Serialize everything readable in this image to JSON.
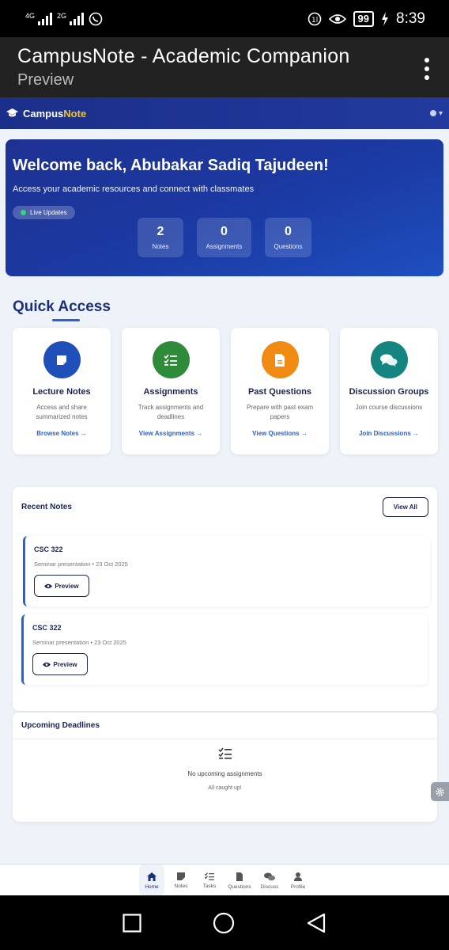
{
  "status_bar": {
    "net1": "4G",
    "net2": "2G",
    "battery": "99",
    "time": "8:39",
    "icons": [
      "whatsapp-icon",
      "data-saver-icon",
      "eye-icon",
      "charging-icon"
    ]
  },
  "appbar": {
    "title": "CampusNote - Academic Companion",
    "subtitle": "Preview"
  },
  "navbar": {
    "brand_prefix": "Campus",
    "brand_accent": "Note",
    "user_icon": "user-circle-icon"
  },
  "hero": {
    "heading": "Welcome back, Abubakar Sadiq Tajudeen!",
    "subtitle": "Access your academic resources and connect with classmates",
    "live_label": "Live Updates",
    "stats": [
      {
        "value": "2",
        "label": "Notes"
      },
      {
        "value": "0",
        "label": "Assignments"
      },
      {
        "value": "0",
        "label": "Questions"
      }
    ]
  },
  "quick_access": {
    "title": "Quick Access",
    "cards": [
      {
        "title": "Lecture Notes",
        "desc": "Access and share summarized notes",
        "link": "Browse Notes →",
        "color": "#1f4fb8",
        "icon": "note-icon"
      },
      {
        "title": "Assignments",
        "desc": "Track assignments and deadlines",
        "link": "View Assignments →",
        "color": "#2e8b3a",
        "icon": "checklist-icon"
      },
      {
        "title": "Past Questions",
        "desc": "Prepare with past exam papers",
        "link": "View Questions →",
        "color": "#f08a12",
        "icon": "file-icon"
      },
      {
        "title": "Discussion Groups",
        "desc": "Join course discussions",
        "link": "Join Discussions →",
        "color": "#15857f",
        "icon": "comments-icon"
      }
    ]
  },
  "recent_notes": {
    "title": "Recent Notes",
    "view_all": "View All",
    "items": [
      {
        "course": "CSC 322",
        "meta": "Seminar presentation • 23 Oct 2025",
        "preview": "Preview"
      },
      {
        "course": "CSC 322",
        "meta": "Seminar presentation • 23 Oct 2025",
        "preview": "Preview"
      }
    ]
  },
  "deadlines": {
    "title": "Upcoming Deadlines",
    "empty_message": "No upcoming assignments",
    "empty_sub": "All caught up!"
  },
  "bottom_nav": [
    {
      "label": "Home",
      "icon": "home-icon"
    },
    {
      "label": "Notes",
      "icon": "note-icon"
    },
    {
      "label": "Tasks",
      "icon": "tasks-icon"
    },
    {
      "label": "Questions",
      "icon": "file-icon"
    },
    {
      "label": "Discuss",
      "icon": "comments-icon"
    },
    {
      "label": "Profile",
      "icon": "user-icon"
    }
  ]
}
